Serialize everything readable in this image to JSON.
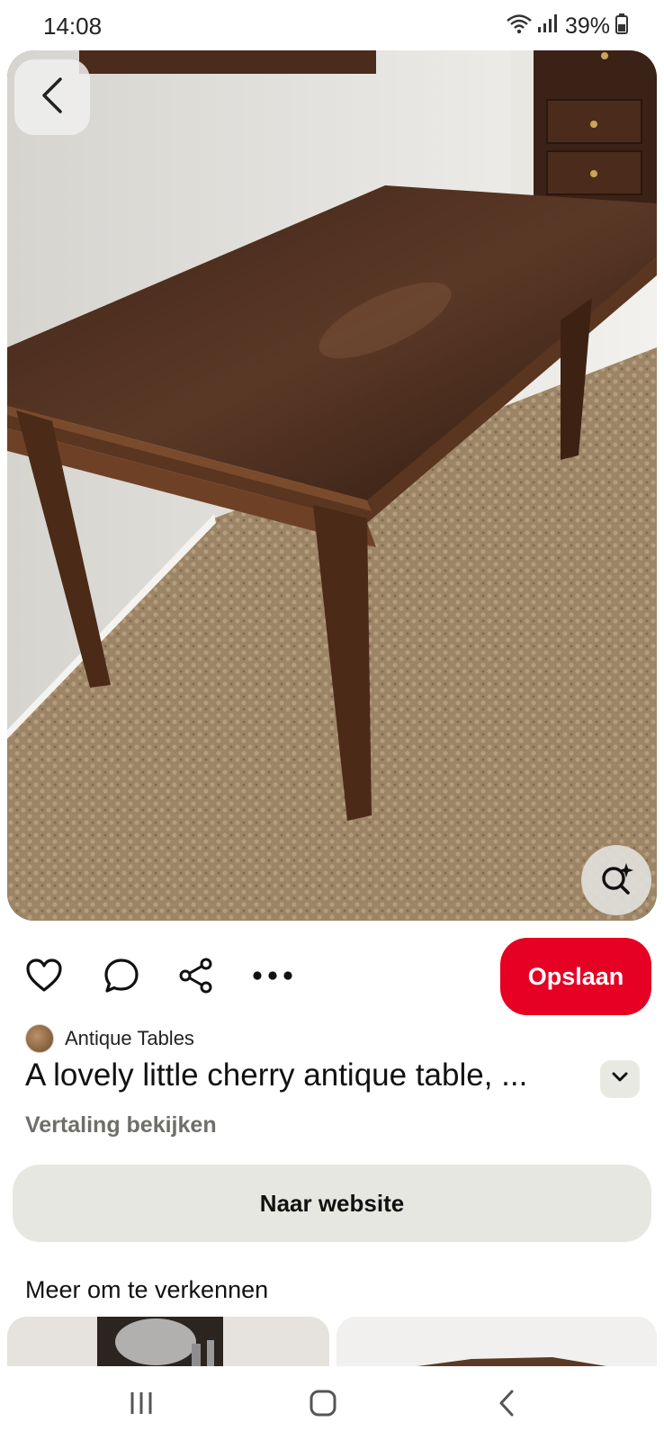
{
  "status_bar": {
    "time": "14:08",
    "battery": "39%",
    "icons": [
      "wifi-icon",
      "signal-icon",
      "battery-icon"
    ]
  },
  "hero": {
    "icons": {
      "back": "chevron-left-icon",
      "lens": "visual-search-icon"
    }
  },
  "actions": {
    "icons": [
      "heart-icon",
      "comment-icon",
      "share-icon",
      "more-icon"
    ],
    "save_label": "Opslaan"
  },
  "pin": {
    "creator": "Antique Tables",
    "title": "A lovely little cherry antique table, ...",
    "translate_label": "Vertaling bekijken",
    "website_label": "Naar website"
  },
  "more": {
    "heading": "Meer om te verkennen"
  },
  "nav": {
    "icons": [
      "recent-apps-icon",
      "home-icon",
      "back-icon"
    ]
  },
  "colors": {
    "save_button": "#e60023",
    "secondary_button": "#e7e7e2",
    "subtle_text": "#6f6f69"
  }
}
